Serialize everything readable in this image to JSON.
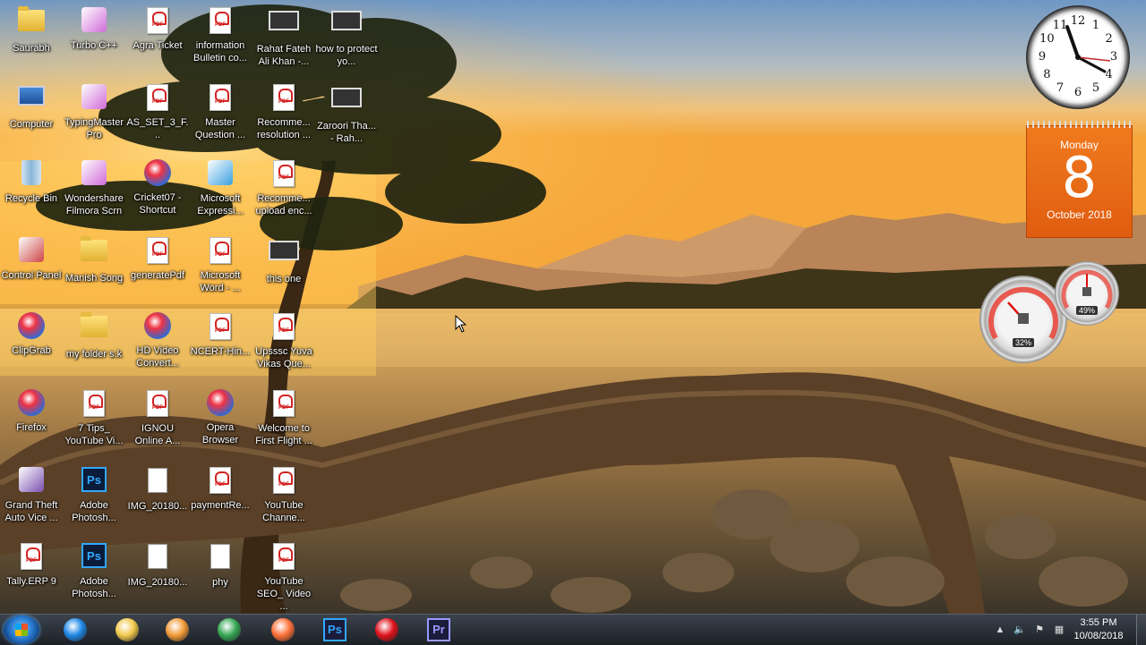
{
  "desktop": {
    "icons": [
      {
        "label": "Saurabh",
        "type": "folder"
      },
      {
        "label": "Turbo C++",
        "type": "app"
      },
      {
        "label": "Agra Ticket",
        "type": "pdf"
      },
      {
        "label": "information Bulletin co...",
        "type": "pdf"
      },
      {
        "label": "Rahat Fateh Ali Khan -...",
        "type": "video"
      },
      {
        "label": "how to protect yo...",
        "type": "video"
      },
      {
        "label": "Computer",
        "type": "monitor"
      },
      {
        "label": "TypingMaster Pro",
        "type": "app"
      },
      {
        "label": "AS_SET_3_F...",
        "type": "pdf"
      },
      {
        "label": "Master Question ...",
        "type": "pdf"
      },
      {
        "label": "Recomme... resolution ...",
        "type": "pdf"
      },
      {
        "label": "Zaroori Tha... - Rah...",
        "type": "video"
      },
      {
        "label": "Recycle Bin",
        "type": "bin"
      },
      {
        "label": "Wondershare Filmora Scrn",
        "type": "app"
      },
      {
        "label": "Cricket07 - Shortcut",
        "type": "round"
      },
      {
        "label": "Microsoft Expressi...",
        "type": "app"
      },
      {
        "label": "Recomme... upload enc...",
        "type": "pdf"
      },
      {
        "label": "Control Panel",
        "type": "app"
      },
      {
        "label": "Manish Song",
        "type": "folder"
      },
      {
        "label": "generatePdf",
        "type": "pdf"
      },
      {
        "label": "Microsoft Word - ...",
        "type": "pdf"
      },
      {
        "label": "this one",
        "type": "video"
      },
      {
        "label": "ClipGrab",
        "type": "round"
      },
      {
        "label": "my folder s.k",
        "type": "folder"
      },
      {
        "label": "HD Video Convert...",
        "type": "round"
      },
      {
        "label": "NCERT-Hin...",
        "type": "pdf"
      },
      {
        "label": "Upsssc Yuva Vikas Que...",
        "type": "pdf"
      },
      {
        "label": "Firefox",
        "type": "round"
      },
      {
        "label": "7 Tips_ YouTube Vi...",
        "type": "pdf"
      },
      {
        "label": "IGNOU Online A...",
        "type": "pdf"
      },
      {
        "label": "Opera Browser",
        "type": "round"
      },
      {
        "label": "Welcome to First Flight ...",
        "type": "pdf"
      },
      {
        "label": "Grand Theft Auto Vice ...",
        "type": "app"
      },
      {
        "label": "Adobe Photosh...",
        "type": "ps"
      },
      {
        "label": "IMG_20180...",
        "type": "doc"
      },
      {
        "label": "paymentRe...",
        "type": "pdf"
      },
      {
        "label": "YouTube Channe...",
        "type": "pdf"
      },
      {
        "label": "Tally.ERP 9",
        "type": "pdf"
      },
      {
        "label": "Adobe Photosh...",
        "type": "ps"
      },
      {
        "label": "IMG_20180...",
        "type": "doc"
      },
      {
        "label": "phy",
        "type": "doc"
      },
      {
        "label": "YouTube SEO_ Video ...",
        "type": "pdf"
      }
    ]
  },
  "gadgets": {
    "clock": {
      "numbers": [
        "12",
        "1",
        "2",
        "3",
        "4",
        "5",
        "6",
        "7",
        "8",
        "9",
        "10",
        "11"
      ]
    },
    "calendar": {
      "day_name": "Monday",
      "day_number": "8",
      "month_year": "October 2018"
    },
    "cpu_meter": {
      "cpu": "32%",
      "ram": "49%"
    }
  },
  "taskbar": {
    "pinned": [
      {
        "name": "internet-explorer",
        "color": "#1e88e5"
      },
      {
        "name": "file-explorer",
        "color": "#f2c94c"
      },
      {
        "name": "media-player",
        "color": "#f29b38"
      },
      {
        "name": "chrome",
        "color": "#34a853"
      },
      {
        "name": "firefox",
        "color": "#ff7139"
      },
      {
        "name": "photoshop",
        "color": "#31a8ff",
        "text": "Ps"
      },
      {
        "name": "opera",
        "color": "#e0121c"
      },
      {
        "name": "premiere",
        "color": "#9999ff",
        "text": "Pr"
      }
    ],
    "time": "3:55 PM",
    "date": "10/08/2018"
  }
}
